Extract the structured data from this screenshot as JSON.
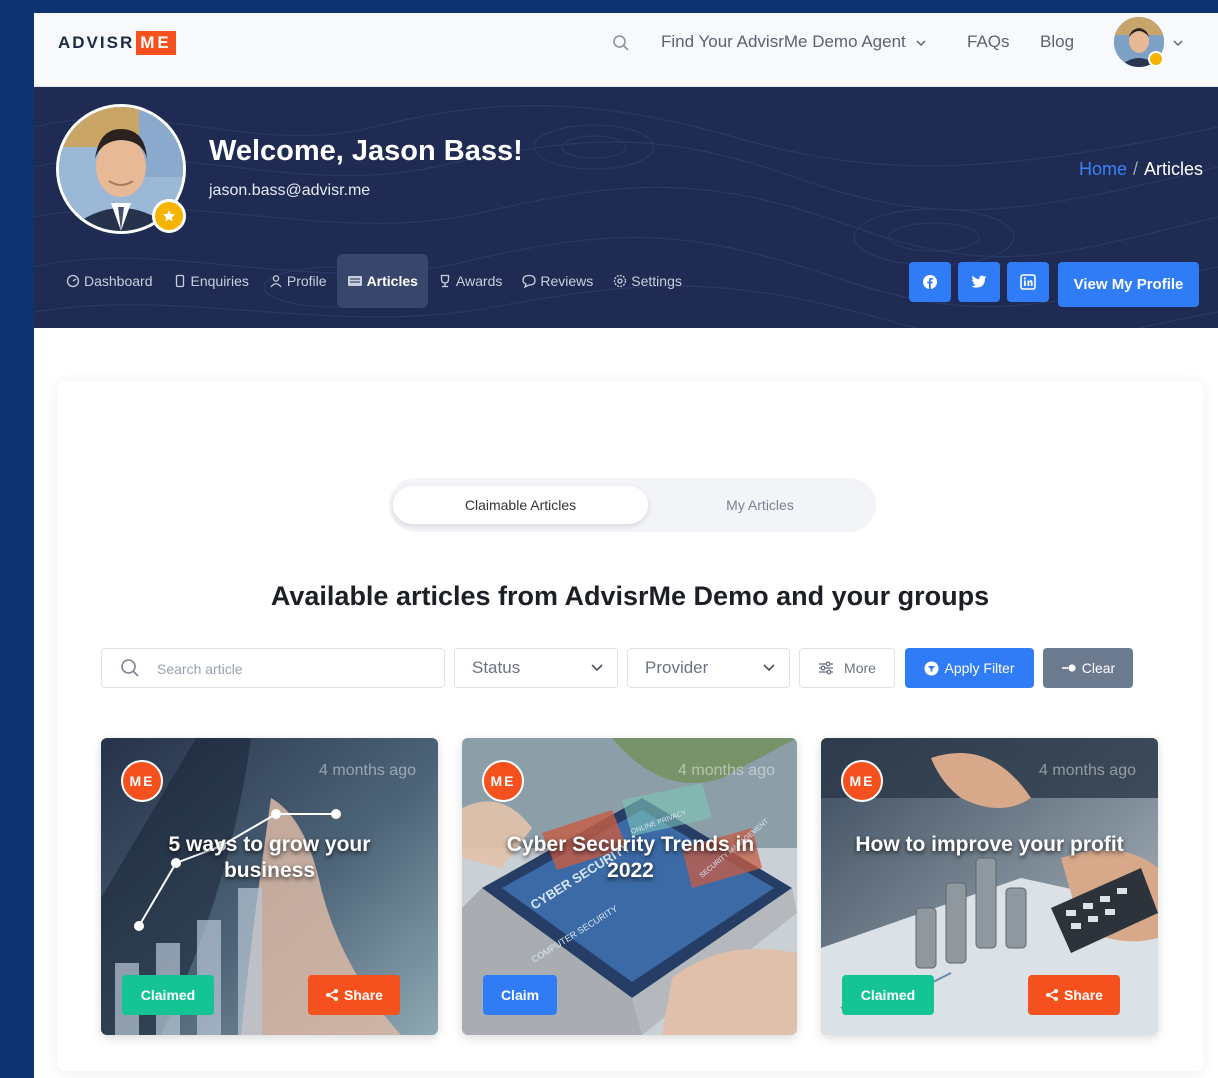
{
  "colors": {
    "accent": "#2f7cf6",
    "brand_orange": "#f4511e",
    "banner": "#1f2b53",
    "claimed": "#14c495",
    "clear": "#6c7a8f",
    "outer_bg": "#0d3470"
  },
  "topnav": {
    "logo_text": "ADVISR",
    "logo_badge": "ME",
    "search_icon": "search-icon",
    "links": [
      "Find Your AdvisrMe Demo Agent",
      "FAQs",
      "Blog"
    ]
  },
  "header": {
    "welcome": "Welcome, Jason Bass!",
    "email": "jason.bass@advisr.me",
    "breadcrumb": {
      "home": "Home",
      "separator": "/",
      "current": "Articles"
    }
  },
  "tabs": [
    {
      "label": "Dashboard",
      "icon": "dashboard-icon",
      "active": false
    },
    {
      "label": "Enquiries",
      "icon": "phone-icon",
      "active": false
    },
    {
      "label": "Profile",
      "icon": "user-icon",
      "active": false
    },
    {
      "label": "Articles",
      "icon": "articles-icon",
      "active": true
    },
    {
      "label": "Awards",
      "icon": "trophy-icon",
      "active": false
    },
    {
      "label": "Reviews",
      "icon": "chat-icon",
      "active": false
    },
    {
      "label": "Settings",
      "icon": "gear-icon",
      "active": false
    }
  ],
  "social": [
    "facebook-icon",
    "twitter-icon",
    "linkedin-icon"
  ],
  "view_profile_label": "View My Profile",
  "segment": {
    "active": "Claimable Articles",
    "inactive": "My Articles"
  },
  "heading": "Available articles from AdvisrMe Demo and your groups",
  "filters": {
    "search_placeholder": "Search article",
    "status_label": "Status",
    "provider_label": "Provider",
    "more_label": "More",
    "apply_label": "Apply Filter",
    "clear_label": "Clear"
  },
  "articles": [
    {
      "logo": "ME",
      "time": "4 months ago",
      "title": "5 ways to grow your business",
      "status": "Claimed",
      "share": "Share"
    },
    {
      "logo": "ME",
      "time": "4 months ago",
      "title": "Cyber Security Trends in 2022",
      "status": "Claim",
      "share": ""
    },
    {
      "logo": "ME",
      "time": "4 months ago",
      "title": "How to improve your profit",
      "status": "Claimed",
      "share": "Share"
    }
  ],
  "article_image_text": [
    "CYBER SECURITY",
    "COMPUTER SECURITY",
    "ONLINE PRIVACY",
    "SECURITY MANAGEMENT"
  ]
}
